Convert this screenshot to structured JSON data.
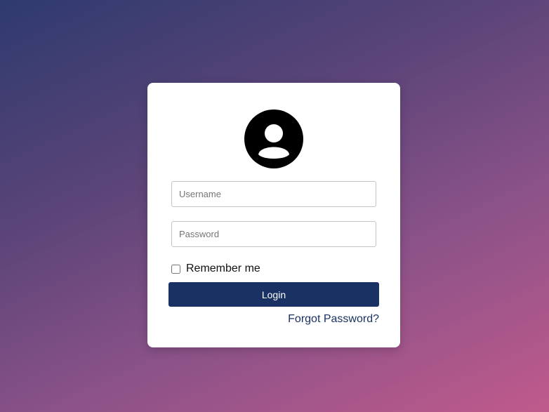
{
  "login_form": {
    "avatar_icon": "user-circle-icon",
    "username": {
      "value": "",
      "placeholder": "Username"
    },
    "password": {
      "value": "",
      "placeholder": "Password"
    },
    "remember_label": "Remember me",
    "remember_checked": false,
    "login_label": "Login",
    "forgot_label": "Forgot Password?"
  },
  "colors": {
    "primary": "#1a3263",
    "background_gradient": [
      "#2e3a6e",
      "#c05a8c"
    ]
  }
}
